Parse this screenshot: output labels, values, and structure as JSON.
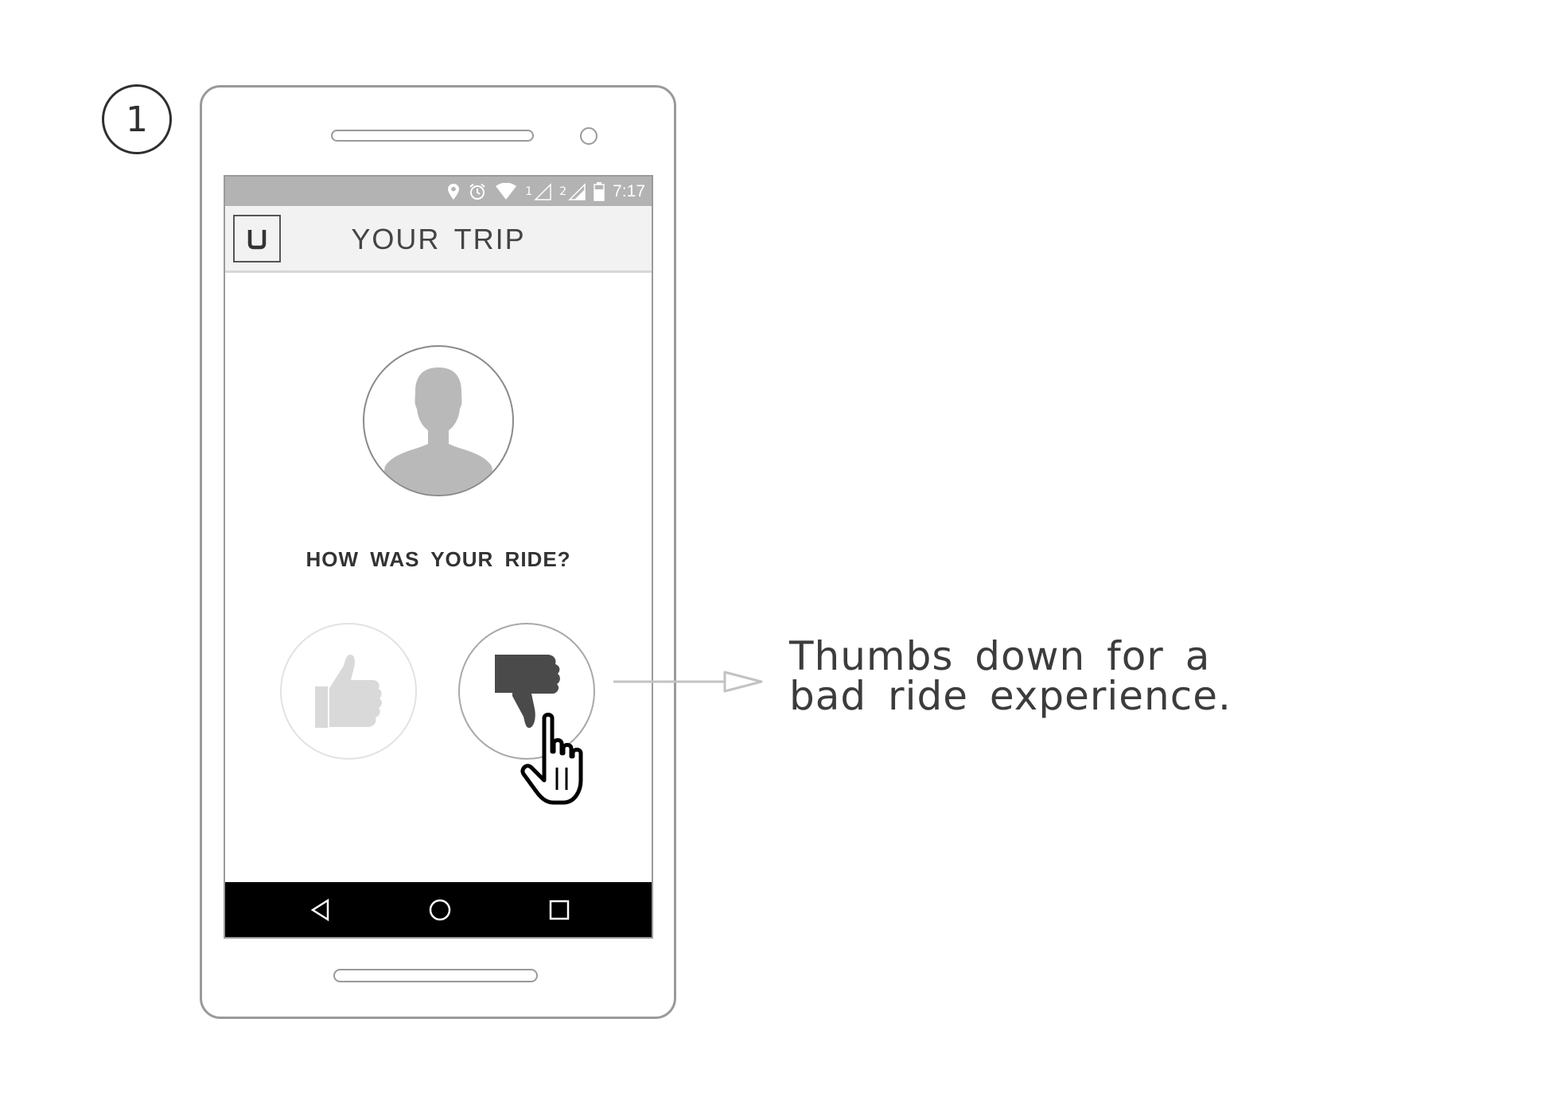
{
  "step": {
    "number": "1"
  },
  "status_bar": {
    "time": "7:17",
    "sim1_label": "1",
    "sim2_label": "2",
    "icons": [
      "location-icon",
      "alarm-icon",
      "wifi-icon",
      "signal-sim1-icon",
      "signal-sim2-icon",
      "battery-icon"
    ]
  },
  "app_bar": {
    "title": "YOUR TRIP",
    "logo_icon": "uber-logo-icon"
  },
  "rating": {
    "question": "HOW WAS YOUR RIDE?",
    "thumbs_up_icon": "thumbs-up-icon",
    "thumbs_down_icon": "thumbs-down-icon",
    "selected": "thumbs-down"
  },
  "nav_bar": {
    "icons": [
      "back-icon",
      "home-icon",
      "recents-icon"
    ]
  },
  "annotation": {
    "line1": "Thumbs down for a",
    "line2": "bad ride experience."
  },
  "colors": {
    "status_bar": "#b3b3b4",
    "app_bar": "#f2f2f2",
    "nav_bar": "#000000",
    "avatar_silhouette": "#b9b9b9",
    "thumbs_up_inactive": "#d9d9d9",
    "thumbs_down_active": "#4a4a4a",
    "device_outline": "#9a9a9a"
  }
}
